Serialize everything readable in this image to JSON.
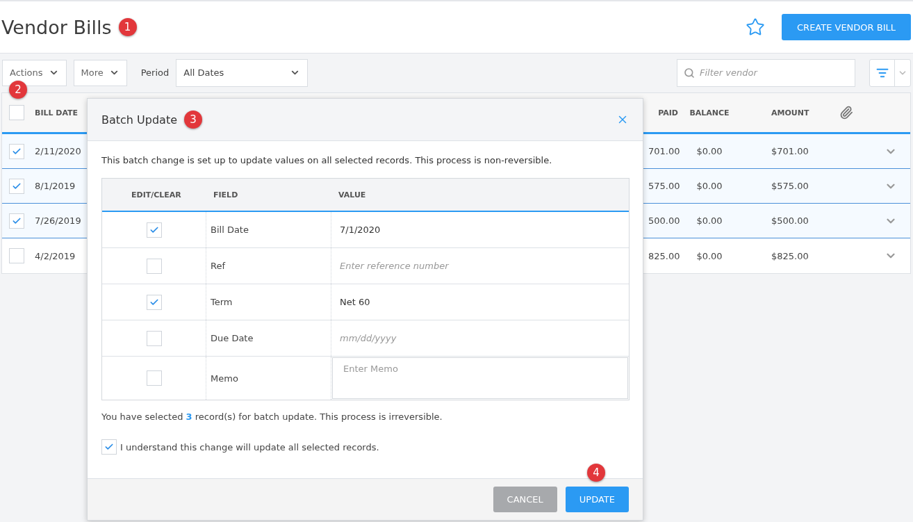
{
  "header": {
    "title": "Vendor Bills",
    "create_button": "CREATE VENDOR BILL"
  },
  "toolbar": {
    "actions": "Actions",
    "more": "More",
    "period_label": "Period",
    "period_value": "All Dates",
    "filter_placeholder": "Filter vendor"
  },
  "table": {
    "select_all": false,
    "columns": [
      "BILL DATE",
      "PAID",
      "BALANCE",
      "AMOUNT"
    ],
    "rows": [
      {
        "selected": true,
        "bill_date": "2/11/2020",
        "paid": "701.00",
        "balance": "$0.00",
        "amount": "$701.00"
      },
      {
        "selected": true,
        "bill_date": "8/1/2019",
        "paid": "575.00",
        "balance": "$0.00",
        "amount": "$575.00"
      },
      {
        "selected": true,
        "bill_date": "7/26/2019",
        "paid": "500.00",
        "balance": "$0.00",
        "amount": "$500.00"
      },
      {
        "selected": false,
        "bill_date": "4/2/2019",
        "paid": "825.00",
        "balance": "$0.00",
        "amount": "$825.00"
      }
    ]
  },
  "dialog": {
    "title": "Batch Update",
    "intro": "This batch change is set up to update values on all selected records. This process is non-reversible.",
    "columns": [
      "EDIT/CLEAR",
      "FIELD",
      "VALUE"
    ],
    "fields": [
      {
        "kind": "input",
        "checked": true,
        "field": "Bill Date",
        "value": "7/1/2020"
      },
      {
        "kind": "input",
        "checked": false,
        "field": "Ref",
        "placeholder": "Enter reference number"
      },
      {
        "kind": "input",
        "checked": true,
        "field": "Term",
        "value": "Net 60"
      },
      {
        "kind": "input",
        "checked": false,
        "field": "Due Date",
        "placeholder": "mm/dd/yyyy"
      },
      {
        "kind": "textarea",
        "checked": false,
        "field": "Memo",
        "placeholder": "Enter Memo"
      }
    ],
    "summary": "You have selected **3** record(s) for batch update. This process is irreversible.",
    "confirm": {
      "label": "I understand this change will update all selected records.",
      "checked": true
    },
    "buttons": [
      {
        "kind": "secondary",
        "label": "CANCEL"
      },
      {
        "kind": "primary",
        "label": "UPDATE"
      }
    ]
  },
  "annotations": [
    "1",
    "2",
    "3",
    "4"
  ]
}
